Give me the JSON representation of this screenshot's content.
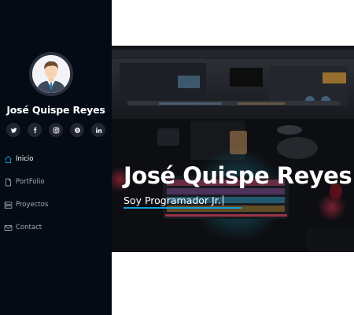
{
  "profile": {
    "name": "José Quispe Reyes"
  },
  "socials": [
    {
      "icon": "twitter-icon"
    },
    {
      "icon": "facebook-icon"
    },
    {
      "icon": "instagram-icon"
    },
    {
      "icon": "skype-icon"
    },
    {
      "icon": "linkedin-icon"
    }
  ],
  "nav": {
    "items": [
      {
        "label": "Inicio",
        "icon": "home-icon",
        "active": true
      },
      {
        "label": "PortFolio",
        "icon": "file-icon",
        "active": false
      },
      {
        "label": "Proyectos",
        "icon": "server-icon",
        "active": false
      },
      {
        "label": "Contact",
        "icon": "envelope-icon",
        "active": false
      }
    ]
  },
  "hero": {
    "title": "José Quispe Reyes",
    "subtitle": "Soy Programador Jr."
  },
  "colors": {
    "sidebar_bg": "#040b14",
    "accent": "#149ddd",
    "nav_text": "#a8a9b4",
    "social_bg": "#212431"
  }
}
